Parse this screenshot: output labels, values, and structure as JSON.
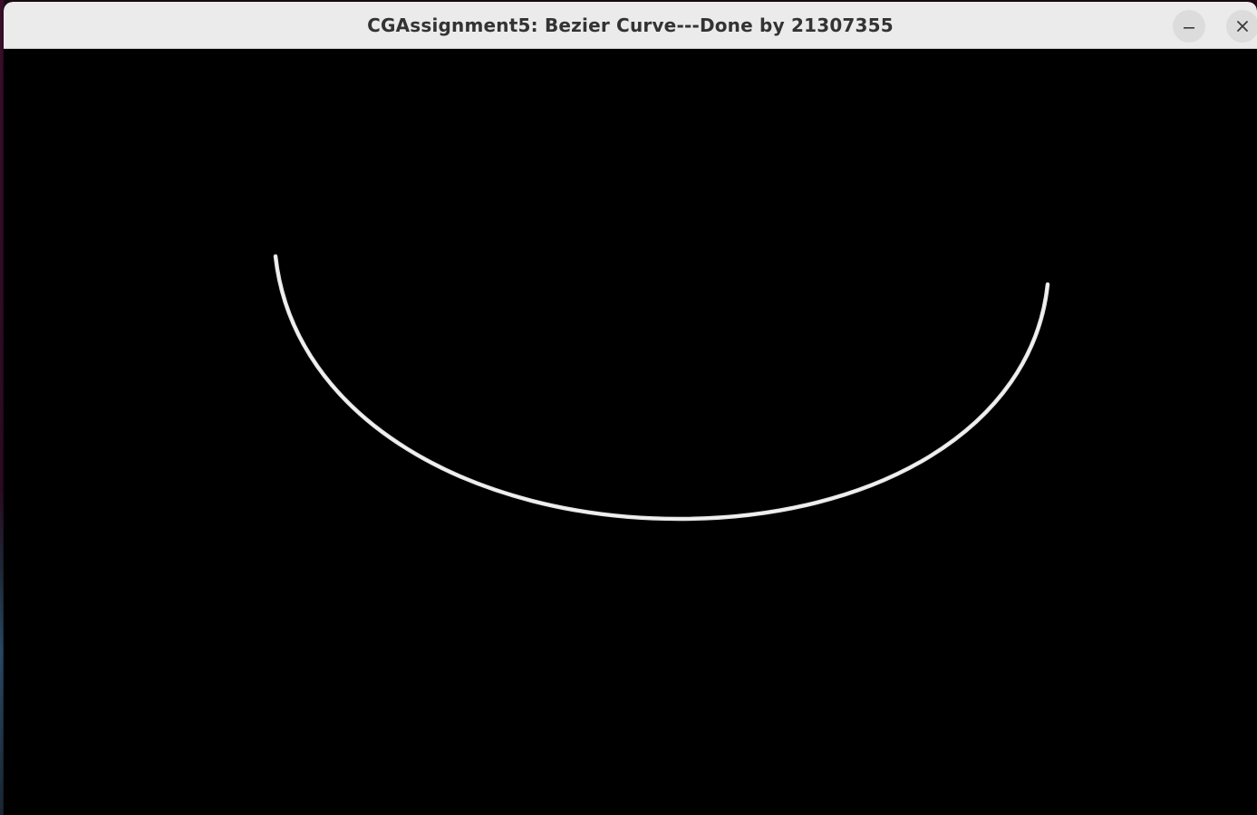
{
  "window": {
    "title": "CGAssignment5: Bezier Curve---Done by 21307355"
  },
  "icons": {
    "minimize": "minimize-icon",
    "close": "close-icon"
  },
  "colors": {
    "titlebar": "#ebebeb",
    "title_text": "#333333",
    "canvas_background": "#000000",
    "curve": "#e6e6e6"
  }
}
